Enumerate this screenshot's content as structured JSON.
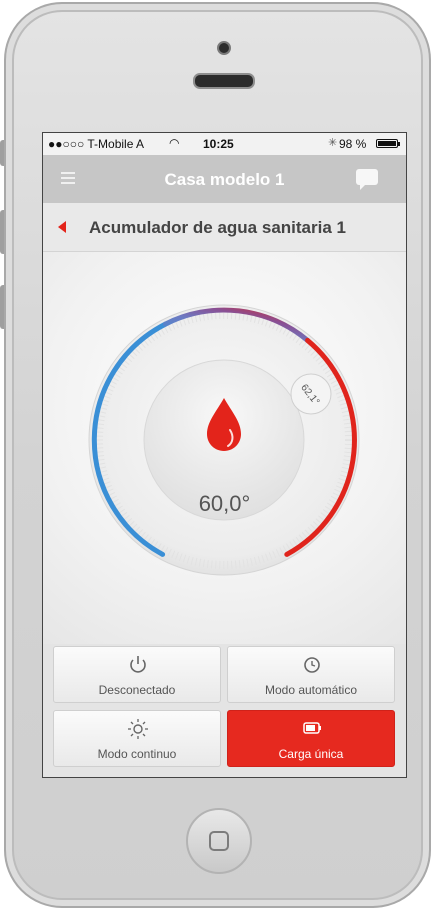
{
  "status_bar": {
    "carrier": "●●○○○ T-Mobile A",
    "time": "10:25",
    "battery": "98 %"
  },
  "navbar": {
    "title": "Casa modelo 1"
  },
  "subheader": {
    "title": "Acumulador de agua sanitaria 1"
  },
  "thermostat": {
    "current_temperature": "60,0°",
    "setpoint": "62,1°",
    "gauge_colors": [
      "#3a8fd6",
      "#7a5ca6",
      "#e0241c"
    ]
  },
  "modes": [
    {
      "label": "Desconectado",
      "icon": "power-icon",
      "active": false
    },
    {
      "label": "Modo automático",
      "icon": "clock-icon",
      "active": false
    },
    {
      "label": "Modo continuo",
      "icon": "sun-icon",
      "active": false
    },
    {
      "label": "Carga única",
      "icon": "battery-icon",
      "active": true
    }
  ],
  "colors": {
    "accent": "#e6291f",
    "navbar": "#c6c6c6"
  }
}
